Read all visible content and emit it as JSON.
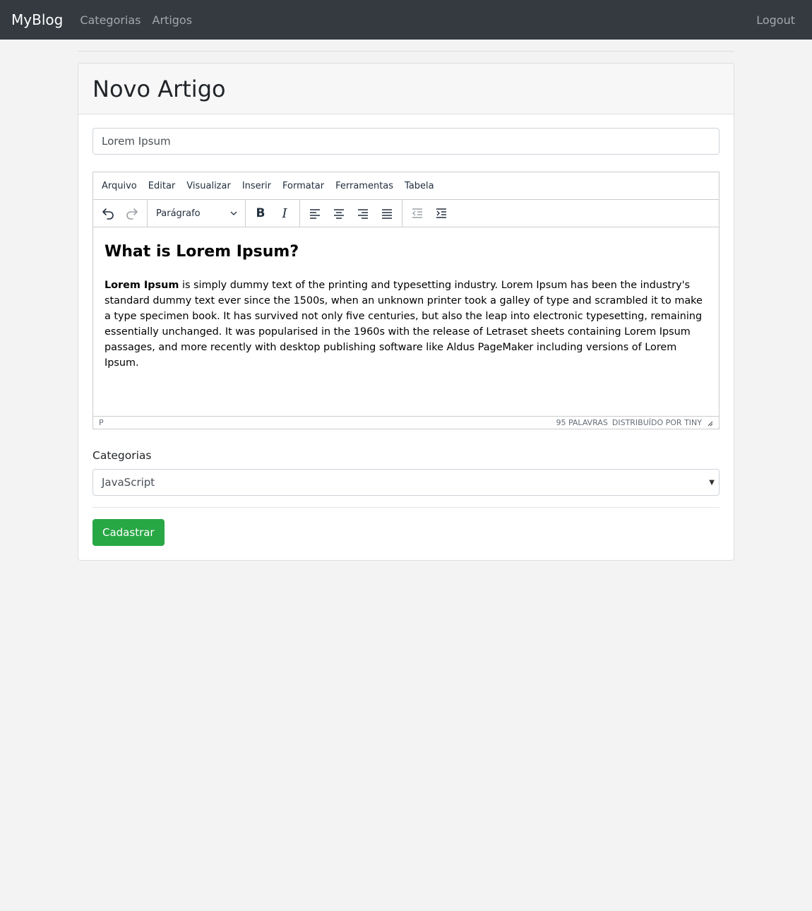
{
  "navbar": {
    "brand": "MyBlog",
    "links": [
      "Categorias",
      "Artigos"
    ],
    "logout": "Logout"
  },
  "page": {
    "title": "Novo Artigo"
  },
  "form": {
    "title_value": "Lorem Ipsum",
    "category_label": "Categorias",
    "category_selected": "JavaScript",
    "submit_label": "Cadastrar"
  },
  "editor": {
    "menu": [
      "Arquivo",
      "Editar",
      "Visualizar",
      "Inserir",
      "Formatar",
      "Ferramentas",
      "Tabela"
    ],
    "block_format": "Parágrafo",
    "toolbar_icons": [
      "undo-icon",
      "redo-icon",
      "bold-icon",
      "italic-icon",
      "align-left-icon",
      "align-center-icon",
      "align-right-icon",
      "align-justify-icon",
      "outdent-icon",
      "indent-icon"
    ],
    "content": {
      "heading": "What is Lorem Ipsum?",
      "para_bold": "Lorem Ipsum",
      "para_text": " is simply dummy text of the printing and typesetting industry. Lorem Ipsum has been the industry's standard dummy text ever since the 1500s, when an unknown printer took a galley of type and scrambled it to make a type specimen book. It has survived not only five centuries, but also the leap into electronic typesetting, remaining essentially unchanged. It was popularised in the 1960s with the release of Letraset sheets containing Lorem Ipsum passages, and more recently with desktop publishing software like Aldus PageMaker including versions of Lorem Ipsum."
    },
    "status": {
      "path": "P",
      "word_count": "95 PALAVRAS",
      "powered_by": "DISTRIBUÍDO POR TINY"
    }
  },
  "colors": {
    "navbar_bg": "#343a40",
    "success": "#28a745",
    "page_bg": "#f3f3f3"
  }
}
